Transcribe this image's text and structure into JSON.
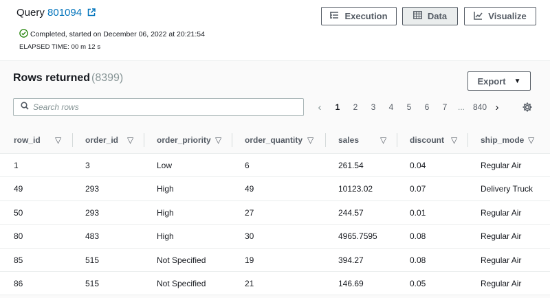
{
  "header": {
    "query_label": "Query",
    "query_id": "801094",
    "status_text": "Completed, started on December 06, 2022 at 20:21:54",
    "elapsed_text": "ELAPSED TIME: 00 m 12 s",
    "tabs": {
      "execution": "Execution",
      "data": "Data",
      "visualize": "Visualize"
    },
    "active_tab": "data"
  },
  "results": {
    "title": "Rows returned",
    "count": "(8399)",
    "export_label": "Export",
    "search_placeholder": "Search rows",
    "pagination": {
      "pages": [
        "1",
        "2",
        "3",
        "4",
        "5",
        "6",
        "7"
      ],
      "current": "1",
      "ellipsis": "...",
      "last": "840"
    }
  },
  "table": {
    "columns": [
      "row_id",
      "order_id",
      "order_priority",
      "order_quantity",
      "sales",
      "discount",
      "ship_mode"
    ],
    "rows": [
      [
        "1",
        "3",
        "Low",
        "6",
        "261.54",
        "0.04",
        "Regular Air"
      ],
      [
        "49",
        "293",
        "High",
        "49",
        "10123.02",
        "0.07",
        "Delivery Truck"
      ],
      [
        "50",
        "293",
        "High",
        "27",
        "244.57",
        "0.01",
        "Regular Air"
      ],
      [
        "80",
        "483",
        "High",
        "30",
        "4965.7595",
        "0.08",
        "Regular Air"
      ],
      [
        "85",
        "515",
        "Not Specified",
        "19",
        "394.27",
        "0.08",
        "Regular Air"
      ],
      [
        "86",
        "515",
        "Not Specified",
        "21",
        "146.69",
        "0.05",
        "Regular Air"
      ]
    ]
  },
  "colors": {
    "link": "#0073bb",
    "success": "#1d8102",
    "border": "#545b64",
    "muted": "#879596",
    "active_tab_bg": "#eaeded"
  },
  "icons": {
    "external_link": "external-link-icon",
    "status": "check-circle-icon",
    "execution": "execution-list-icon",
    "data": "table-grid-icon",
    "visualize": "line-chart-icon",
    "search": "search-icon",
    "settings": "gear-icon",
    "sort": "sort-caret-icon"
  }
}
